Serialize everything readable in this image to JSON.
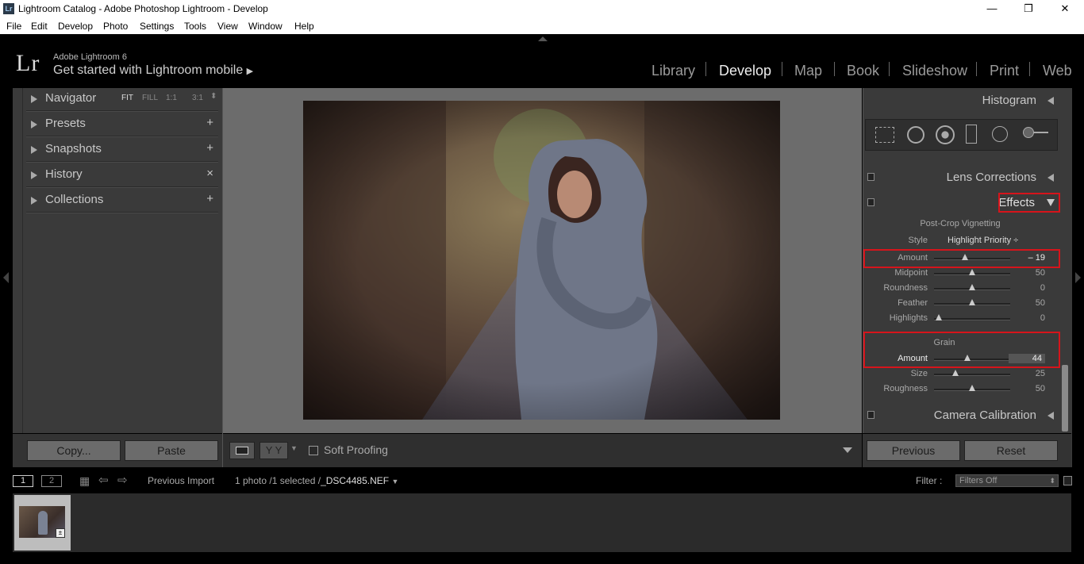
{
  "window": {
    "app_icon": "Lr",
    "title": "Lightroom Catalog - Adobe Photoshop Lightroom - Develop",
    "min": "—",
    "max": "❐",
    "close": "✕"
  },
  "menu": [
    "File",
    "Edit",
    "Develop",
    "Photo",
    "Settings",
    "Tools",
    "View",
    "Window",
    "Help"
  ],
  "identity": {
    "logo": "Lr",
    "version": "Adobe Lightroom 6",
    "mobile": "Get started with Lightroom mobile"
  },
  "modules": [
    "Library",
    "Develop",
    "Map",
    "Book",
    "Slideshow",
    "Print",
    "Web"
  ],
  "active_module": "Develop",
  "left_panels": [
    {
      "label": "Navigator",
      "right": ""
    },
    {
      "label": "Presets",
      "right": "+"
    },
    {
      "label": "Snapshots",
      "right": "+"
    },
    {
      "label": "History",
      "right": "×"
    },
    {
      "label": "Collections",
      "right": "+"
    }
  ],
  "navigator_zoom": [
    "FIT",
    "FILL",
    "1:1",
    "3:1"
  ],
  "copy_label": "Copy...",
  "paste_label": "Paste",
  "soft_proofing": "Soft Proofing",
  "yy_label": "Y Y",
  "right_panels": {
    "histogram": "Histogram",
    "lens": "Lens Corrections",
    "effects": "Effects",
    "calibration": "Camera Calibration"
  },
  "effects": {
    "vignette_title": "Post-Crop Vignetting",
    "style_label": "Style",
    "style_value": "Highlight Priority ÷",
    "vignette": [
      {
        "name": "Amount",
        "value": "– 19",
        "pos": 0.41
      },
      {
        "name": "Midpoint",
        "value": "50",
        "pos": 0.5
      },
      {
        "name": "Roundness",
        "value": "0",
        "pos": 0.5
      },
      {
        "name": "Feather",
        "value": "50",
        "pos": 0.5
      },
      {
        "name": "Highlights",
        "value": "0",
        "pos": 0.06
      }
    ],
    "grain_title": "Grain",
    "grain": [
      {
        "name": "Amount",
        "value": "44",
        "pos": 0.44
      },
      {
        "name": "Size",
        "value": "25",
        "pos": 0.28
      },
      {
        "name": "Roughness",
        "value": "50",
        "pos": 0.5
      }
    ]
  },
  "previous_label": "Previous",
  "reset_label": "Reset",
  "filmstrip": {
    "page1": "1",
    "page2": "2",
    "source": "Previous Import",
    "info_prefix": "1 photo /1 selected /",
    "filename": "_DSC4485.NEF",
    "filter_label": "Filter :",
    "filter_value": "Filters Off"
  },
  "colors": {
    "highlight_box": "#d6141b",
    "panel_bg": "#3a3a3a",
    "center_bg": "#6c6c6c"
  }
}
